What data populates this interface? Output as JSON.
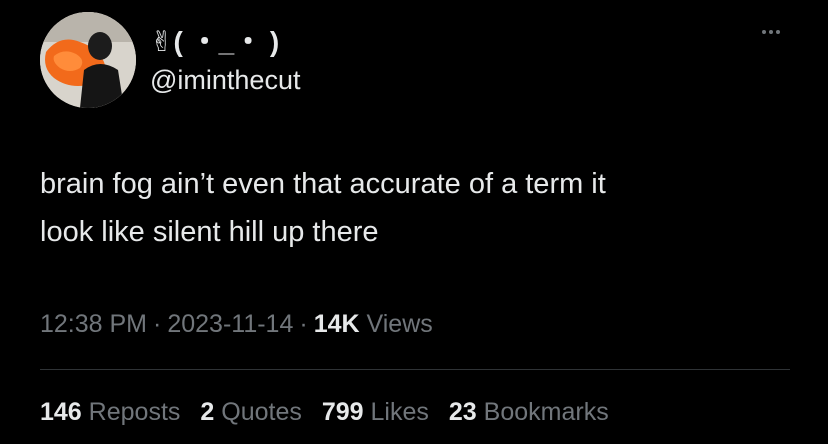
{
  "tweet": {
    "author": {
      "display_name": "✌( ・_・ )",
      "handle": "@iminthecut"
    },
    "text_lines": [
      "brain fog ain’t even that accurate of a term it",
      "look like silent hill up there"
    ],
    "meta": {
      "time": "12:38 PM",
      "separator": "·",
      "date": "2023-11-14",
      "views_count": "14K",
      "views_label": "Views"
    },
    "stats": [
      {
        "count": "146",
        "label": "Reposts"
      },
      {
        "count": "2",
        "label": "Quotes"
      },
      {
        "count": "799",
        "label": "Likes"
      },
      {
        "count": "23",
        "label": "Bookmarks"
      }
    ]
  },
  "icons": {
    "more": "more-horizontal-icon",
    "avatar": "profile-photo"
  },
  "colors": {
    "background": "#000000",
    "primary_text": "#e7e9ea",
    "secondary_text": "#71767b",
    "divider": "#2f3336",
    "avatar_accent": "#f26a1b"
  }
}
